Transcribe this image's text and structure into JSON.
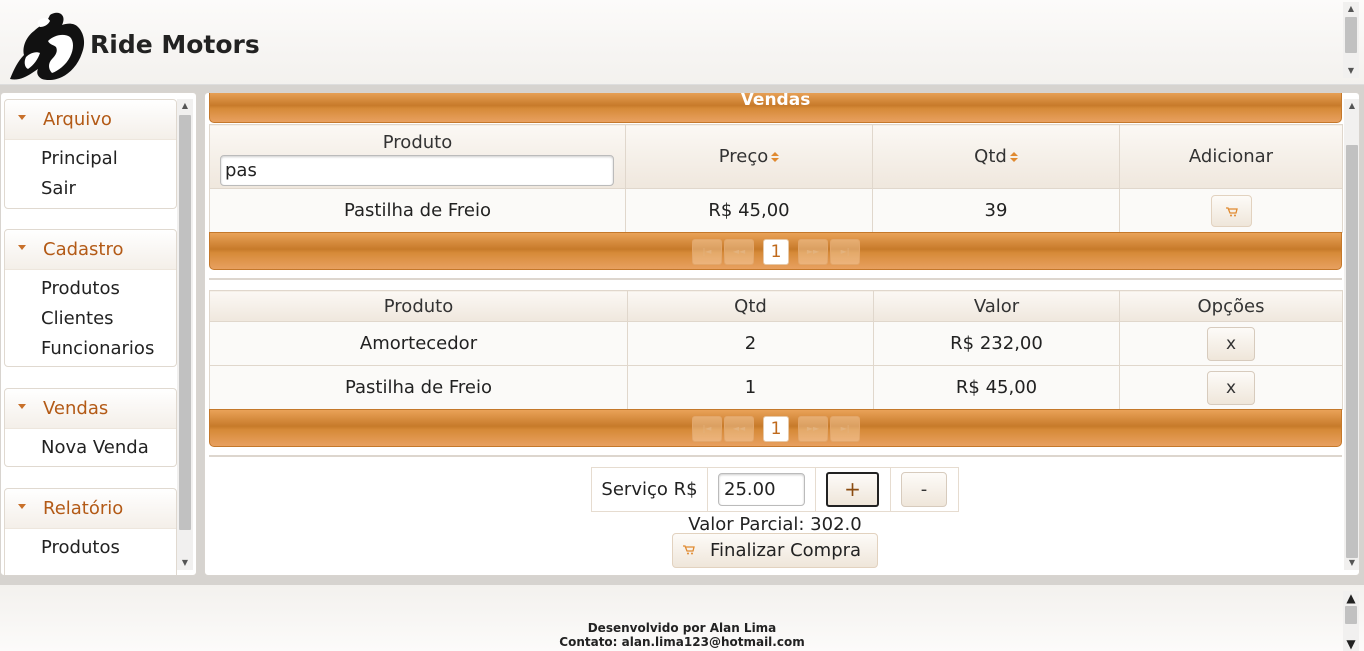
{
  "header": {
    "brand": "Ride Motors"
  },
  "menu": {
    "groups": [
      {
        "title": "Arquivo",
        "items": [
          "Principal",
          "Sair"
        ]
      },
      {
        "title": "Cadastro",
        "items": [
          "Produtos",
          "Clientes",
          "Funcionarios"
        ]
      },
      {
        "title": "Vendas",
        "items": [
          "Nova Venda"
        ]
      },
      {
        "title": "Relatório",
        "items": [
          "Produtos"
        ]
      }
    ]
  },
  "main": {
    "title": "Vendas",
    "products_table": {
      "columns": [
        "Produto",
        "Preço",
        "Qtd",
        "Adicionar"
      ],
      "filter_value": "pas",
      "rows": [
        {
          "produto": "Pastilha de Freio",
          "preco": "R$ 45,00",
          "qtd": "39"
        }
      ],
      "current_page": "1"
    },
    "cart_table": {
      "columns": [
        "Produto",
        "Qtd",
        "Valor",
        "Opções"
      ],
      "rows": [
        {
          "produto": "Amortecedor",
          "qtd": "2",
          "valor": "R$ 232,00",
          "opcao": "x"
        },
        {
          "produto": "Pastilha de Freio",
          "qtd": "1",
          "valor": "R$ 45,00",
          "opcao": "x"
        }
      ],
      "current_page": "1"
    },
    "service": {
      "label": "Serviço R$",
      "value": "25.00",
      "plus": "+",
      "minus": "-"
    },
    "partial": "Valor Parcial: 302.0",
    "finish_label": "Finalizar Compra"
  },
  "footer": {
    "line1": "Desenvolvido por Alan Lima",
    "line2": "Contato: alan.lima123@hotmail.com"
  },
  "colors": {
    "accent": "#d68a38",
    "menu_title": "#b35a16"
  }
}
